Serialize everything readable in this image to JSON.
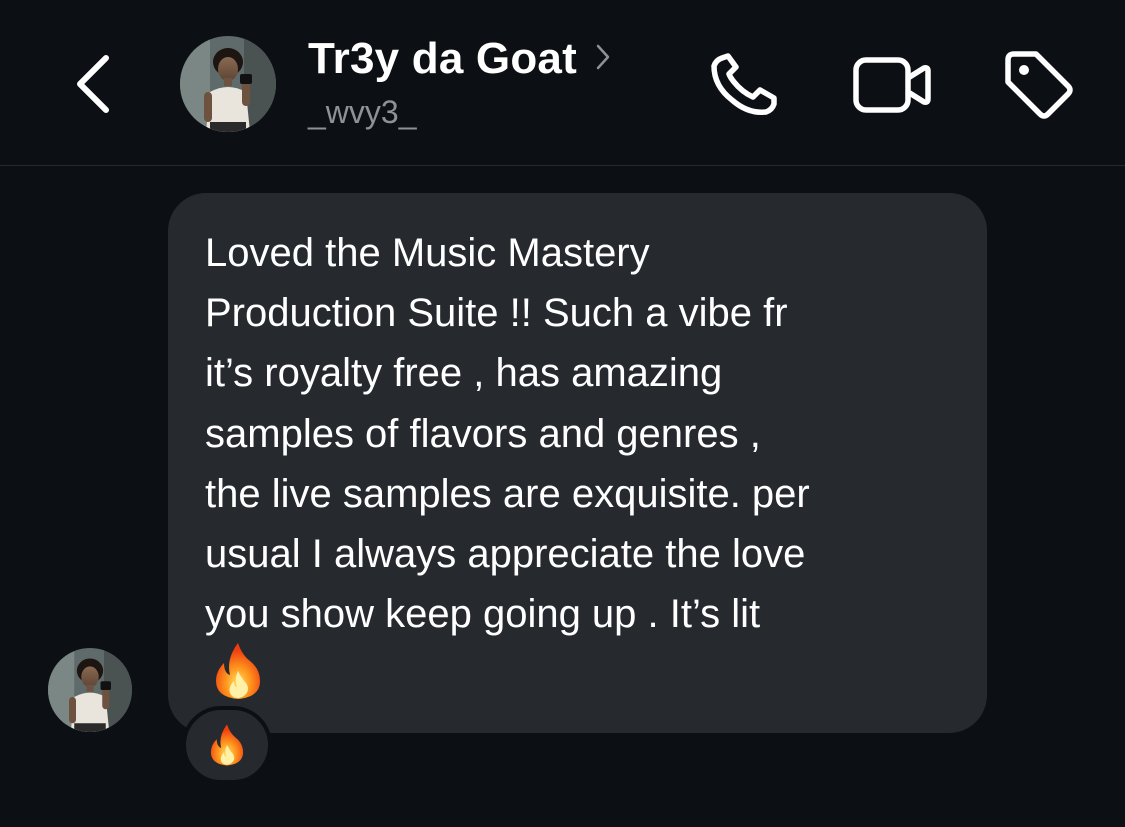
{
  "header": {
    "back_icon": "chevron-left-icon",
    "contact_name": "Tr3y da Goat",
    "contact_username": "_wvy3_",
    "name_chevron_icon": "chevron-right-icon",
    "actions": [
      {
        "name": "call",
        "icon": "phone-icon"
      },
      {
        "name": "video",
        "icon": "video-camera-icon"
      },
      {
        "name": "tag",
        "icon": "tag-icon"
      }
    ]
  },
  "conversation": {
    "messages": [
      {
        "sender": "Tr3y da Goat",
        "text": "Loved the Music Mastery\nProduction Suite !! Such a vibe fr\nit’s royalty free , has amazing\nsamples of flavors and genres ,\nthe live samples are exquisite. per\nusual I always appreciate the love\nyou show keep going up . It’s lit",
        "emoji": "fire-emoji",
        "reaction": "fire-emoji"
      }
    ]
  },
  "colors": {
    "background": "#0c1014",
    "bubble": "#262a2f",
    "text": "#ffffff",
    "secondary_text": "#8e9297"
  }
}
